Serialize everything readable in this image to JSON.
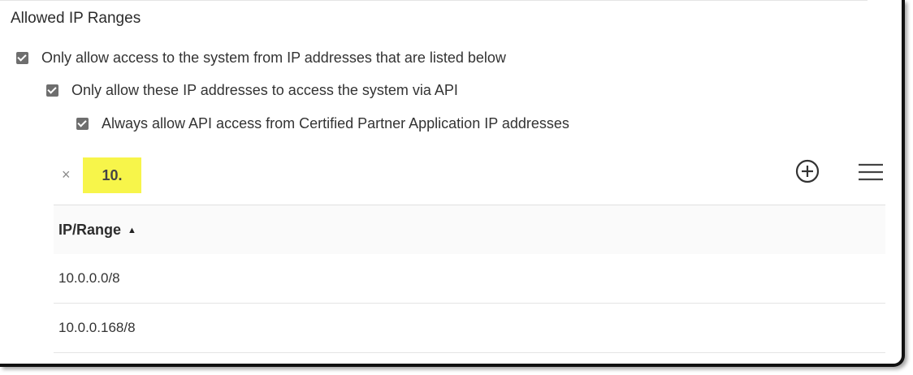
{
  "section": {
    "title": "Allowed IP Ranges"
  },
  "options": [
    {
      "label": "Only allow access to the system from IP addresses that are listed below",
      "checked": true
    },
    {
      "label": "Only allow these IP addresses to access the system via API",
      "checked": true
    },
    {
      "label": "Always allow API access from Certified Partner Application IP addresses",
      "checked": true
    }
  ],
  "toolbar": {
    "clear_icon": "×",
    "filter_value": "10.",
    "filter_highlight_color": "#f7f54a",
    "add_icon": "plus-circle-icon",
    "menu_icon": "hamburger-menu-icon"
  },
  "table": {
    "columns": [
      {
        "label": "IP/Range",
        "sort": "ascending",
        "sort_glyph": "▲"
      }
    ],
    "rows": [
      {
        "ip_range": "10.0.0.0/8"
      },
      {
        "ip_range": "10.0.0.168/8"
      }
    ]
  }
}
